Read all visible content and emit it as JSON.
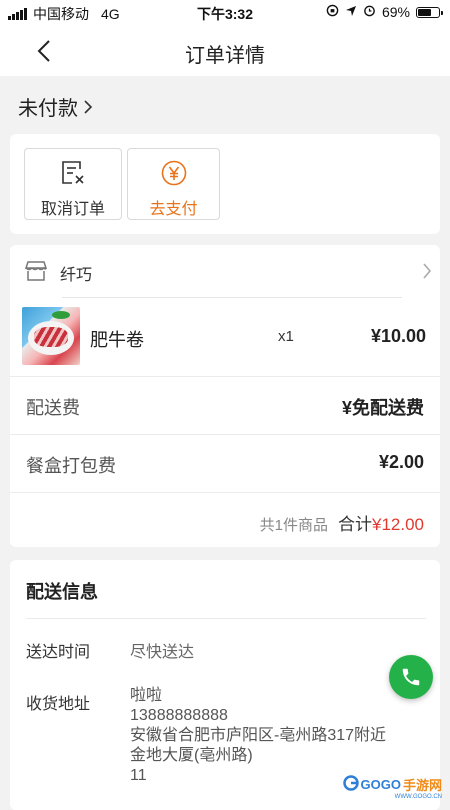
{
  "status_bar": {
    "carrier": "中国移动",
    "network": "4G",
    "time": "下午3:32",
    "battery": "69%",
    "battery_level": 0.69
  },
  "nav": {
    "title": "订单详情",
    "back_icon": "chevron-left-icon"
  },
  "order_status": "未付款",
  "actions": {
    "cancel_label": "取消订单",
    "cancel_icon": "cancel-document-icon",
    "pay_label": "去支付",
    "pay_icon": "yen-circle-icon",
    "accent_color": "#e8731a"
  },
  "shop": {
    "name": "纤巧",
    "icon": "store-icon"
  },
  "items": [
    {
      "name": "肥牛卷",
      "qty": "x1",
      "price": "¥10.00"
    }
  ],
  "fees": [
    {
      "label": "配送费",
      "value": "¥免配送费"
    },
    {
      "label": "餐盒打包费",
      "value": "¥2.00"
    }
  ],
  "summary": {
    "count_text": "共1件商品",
    "total_label": "合计",
    "total_amount": "¥12.00",
    "total_color": "#e03a2f"
  },
  "delivery": {
    "title": "配送信息",
    "time_label": "送达时间",
    "time_value": "尽快送达",
    "address_label": "收货地址",
    "address_lines": [
      "啦啦",
      "13888888888",
      "安徽省合肥市庐阳区-亳州路317附近",
      "金地大厦(亳州路)",
      "11"
    ]
  },
  "call_button_icon": "phone-icon",
  "watermark": {
    "text_main": "GOGO",
    "text_orange": "手游网",
    "text_sub": "WWW.GOGO.CN"
  }
}
